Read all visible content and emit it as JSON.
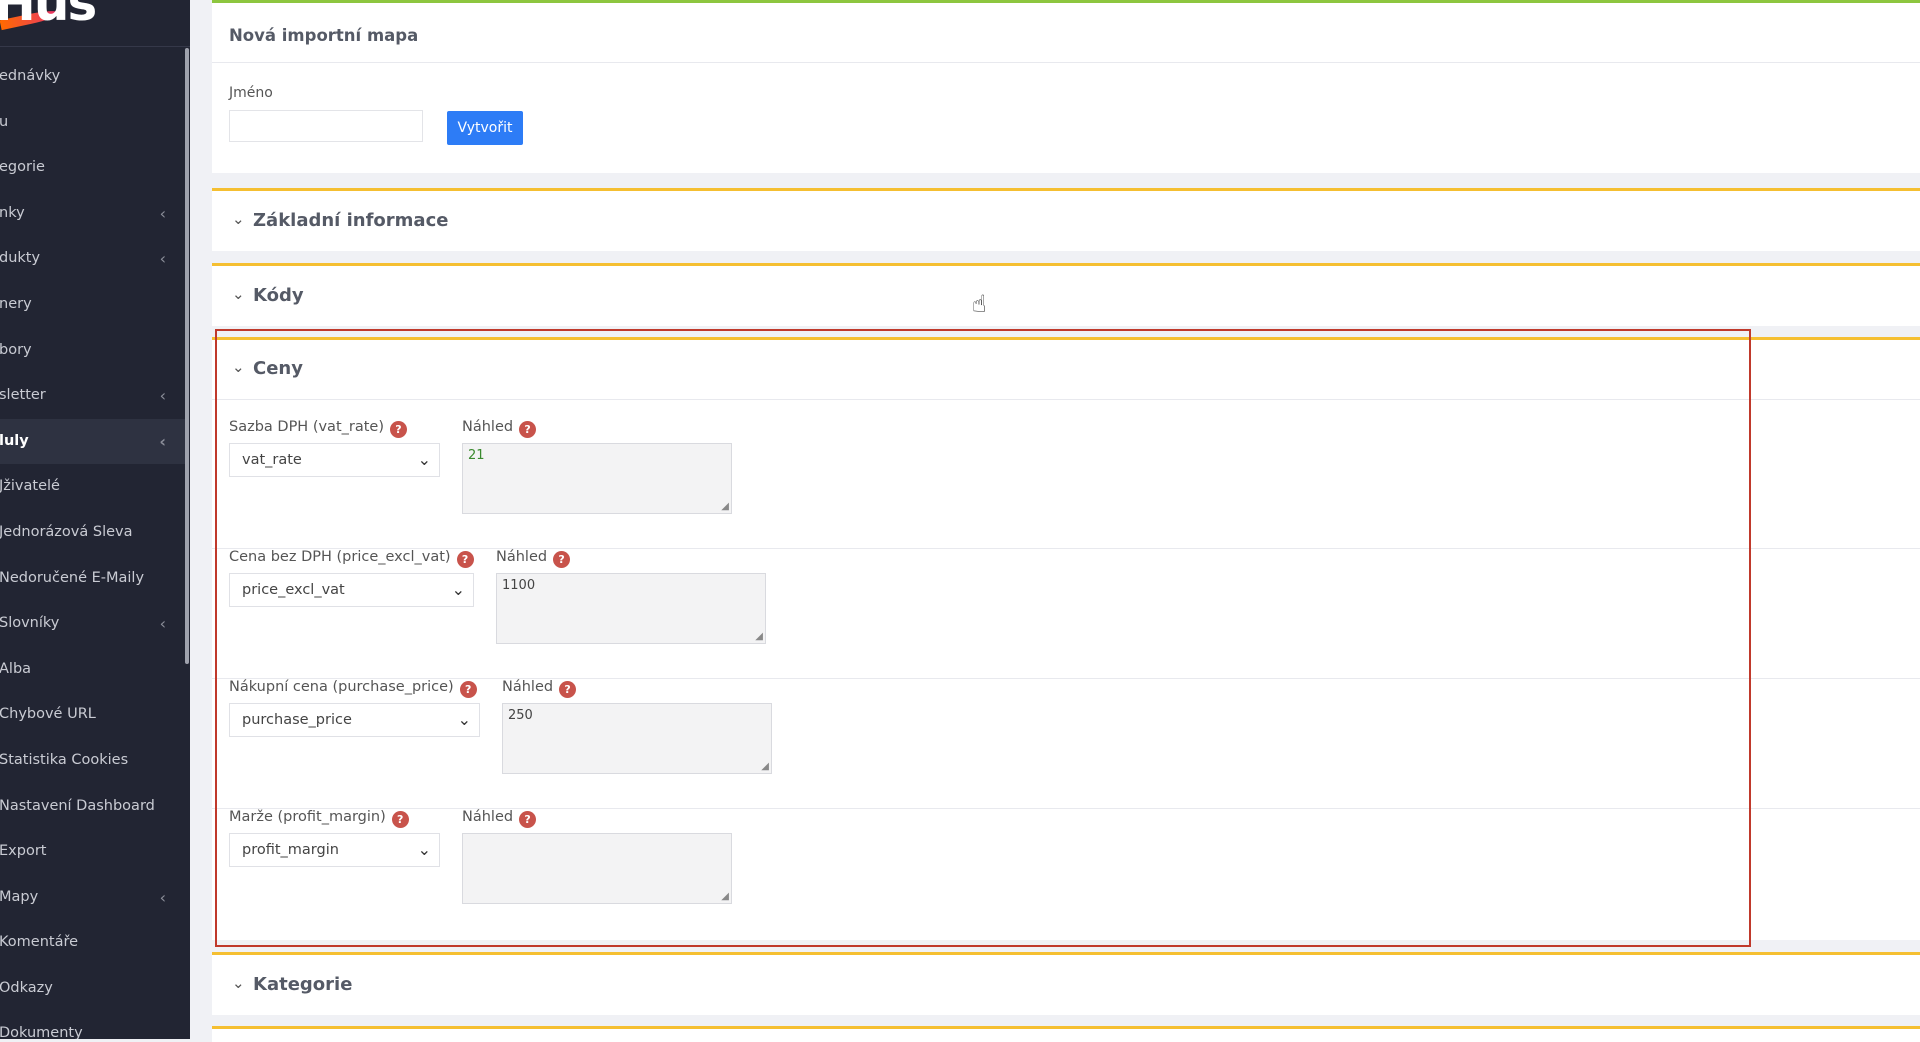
{
  "sidebar": {
    "logo": "Hus",
    "items": [
      {
        "label": "ednávky",
        "chevron": false
      },
      {
        "label": "u",
        "chevron": false
      },
      {
        "label": "egorie",
        "chevron": false
      },
      {
        "label": "nky",
        "chevron": true
      },
      {
        "label": "dukty",
        "chevron": true
      },
      {
        "label": "nery",
        "chevron": false
      },
      {
        "label": "bory",
        "chevron": false
      },
      {
        "label": "sletter",
        "chevron": true
      },
      {
        "label": "luly",
        "chevron": true,
        "active": true
      },
      {
        "label": "Jživatelé",
        "chevron": false
      },
      {
        "label": "Jednorázová Sleva",
        "chevron": false
      },
      {
        "label": "Nedoručené E-Maily",
        "chevron": false
      },
      {
        "label": "Slovníky",
        "chevron": true
      },
      {
        "label": "Alba",
        "chevron": false
      },
      {
        "label": "Chybové URL",
        "chevron": false
      },
      {
        "label": "Statistika Cookies",
        "chevron": false
      },
      {
        "label": "Nastavení Dashboard",
        "chevron": false
      },
      {
        "label": "Export",
        "chevron": false
      },
      {
        "label": "Mapy",
        "chevron": true
      },
      {
        "label": "Komentáře",
        "chevron": false
      },
      {
        "label": "Odkazy",
        "chevron": false
      },
      {
        "label": "Dokumenty",
        "chevron": false
      }
    ]
  },
  "new_map": {
    "title": "Nová importní mapa",
    "name_label": "Jméno",
    "name_value": "",
    "create_button": "Vytvořit"
  },
  "sections": {
    "zakladni": "Základní informace",
    "kody": "Kódy",
    "ceny": "Ceny",
    "kategorie": "Kategorie"
  },
  "chevron_glyph": "⌄",
  "help_glyph": "?",
  "ceny_fields": [
    {
      "label": "Sazba DPH (vat_rate)",
      "selected": "vat_rate",
      "preview_label": "Náhled",
      "preview_value": "21",
      "preview_color": "#3a8a2e"
    },
    {
      "label": "Cena bez DPH (price_excl_vat)",
      "selected": "price_excl_vat",
      "preview_label": "Náhled",
      "preview_value": "1100",
      "preview_color": "#444444"
    },
    {
      "label": "Nákupní cena (purchase_price)",
      "selected": "purchase_price",
      "preview_label": "Náhled",
      "preview_value": "250",
      "preview_color": "#444444"
    },
    {
      "label": "Marže (profit_margin)",
      "selected": "profit_margin",
      "preview_label": "Náhled",
      "preview_value": "",
      "preview_color": "#444444"
    }
  ],
  "colors": {
    "sidebar_bg": "#222533",
    "accent_blue": "#2d7cf6",
    "border_green": "#8dc63f",
    "border_yellow": "#f5bf31",
    "help_red": "#c8534b",
    "highlight_red": "#c0392b"
  }
}
